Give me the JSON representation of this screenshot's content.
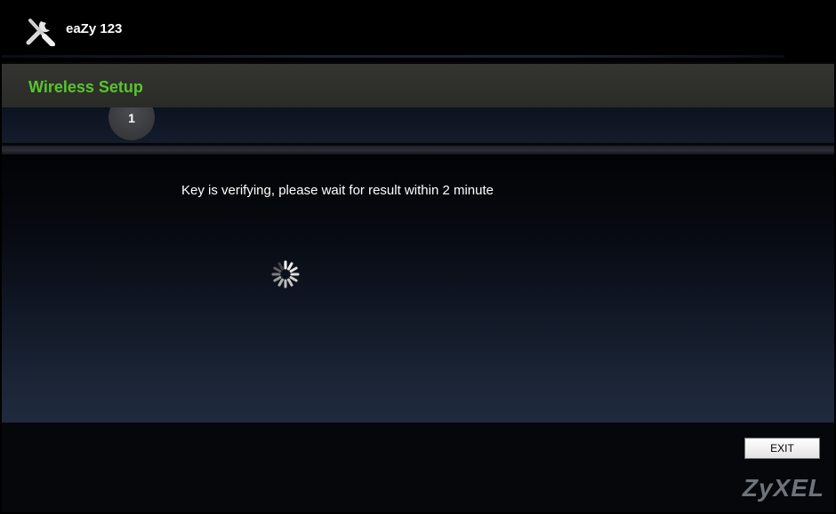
{
  "header": {
    "app_title": "eaZy 123",
    "logo_icon": "tools-wrench-screwdriver-icon"
  },
  "section": {
    "title": "Wireless Setup",
    "step_number": "1"
  },
  "main": {
    "status_text": "Key is verifying, please wait for result within 2 minute",
    "spinner_icon": "loading-spinner-icon"
  },
  "footer": {
    "exit_label": "EXIT",
    "brand": "ZyXEL"
  },
  "colors": {
    "accent_green": "#55c62c",
    "background": "#05060a",
    "brand_gray": "#6e737c"
  }
}
